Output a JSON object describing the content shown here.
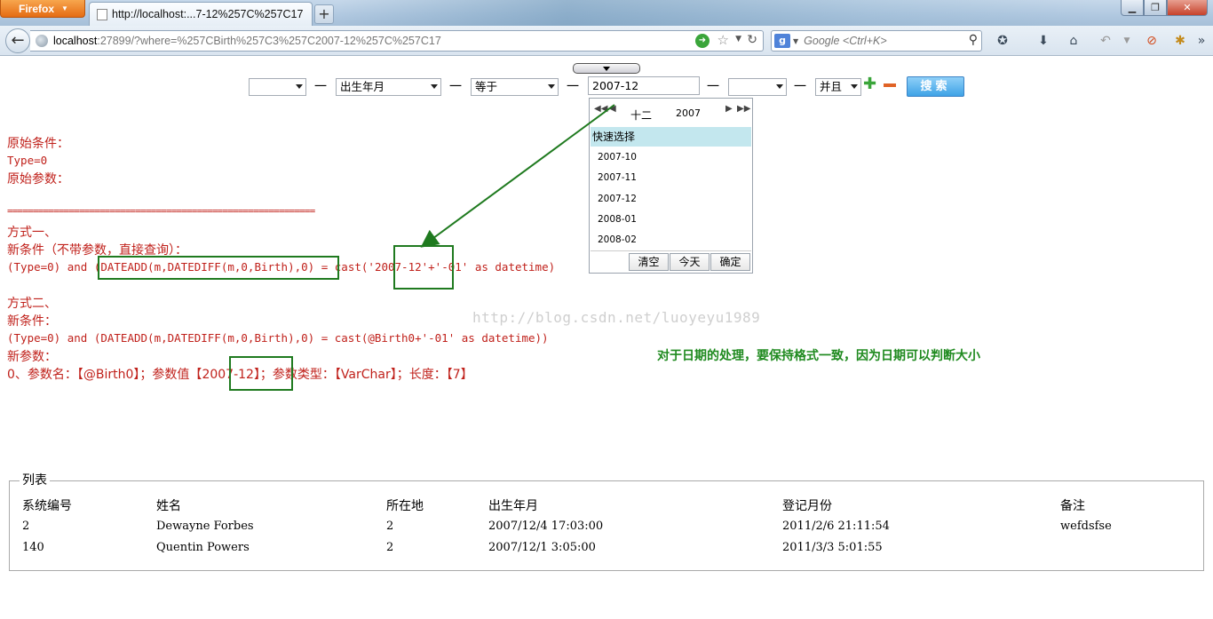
{
  "browser": {
    "app_button": "Firefox",
    "tab_title": "http://localhost:...7-12%257C%257C17",
    "new_tab": "+",
    "url_host": "localhost",
    "url_rest": ":27899/?where=%257CBirth%257C3%257C2007-12%257C%257C17",
    "search_placeholder": "Google <Ctrl+K>",
    "search_engine": "g"
  },
  "filter": {
    "field1": "",
    "field2": "出生年月",
    "operator": "等于",
    "value": "2007-12",
    "field5": "",
    "connector": "并且",
    "dash": "一",
    "search_label": "搜索"
  },
  "picker": {
    "month": "十二",
    "year": "2007",
    "quick_label": "快速选择",
    "options": [
      "2007-10",
      "2007-11",
      "2007-12",
      "2008-01",
      "2008-02"
    ],
    "clear": "清空",
    "today": "今天",
    "ok": "确定"
  },
  "output": {
    "orig_cond_label": "原始条件：",
    "orig_cond": "Type=0",
    "orig_params_label": "原始参数：",
    "separator": "============================================================",
    "method1": "方式一、",
    "new_cond_noparam": "新条件（不带参数，直接查询）：",
    "sql1_a": "(Type=0) and ",
    "sql1_b": "(DATEADD(m,DATEDIFF(m,0,Birth),0)",
    "sql1_c": " = cast('",
    "sql1_d": "2007-12",
    "sql1_e": "'+'-01' as datetime)",
    "method2": "方式二、",
    "new_cond": "新条件：",
    "sql2": "(Type=0) and (DATEADD(m,DATEDIFF(m,0,Birth),0) = cast(@Birth0+'-01' as datetime))",
    "new_params": "新参数：",
    "param_a": "0、参数名：【@Birth0】；参数值【",
    "param_value": "2007-12",
    "param_b": "】；参数类型：【VarChar】；长度：【7】",
    "note": "对于日期的处理，要保持格式一致，因为日期可以判断大小",
    "watermark": "http://blog.csdn.net/luoyeyu1989"
  },
  "list": {
    "legend": "列表",
    "headers": [
      "系统编号",
      "姓名",
      "所在地",
      "出生年月",
      "登记月份",
      "备注"
    ],
    "rows": [
      [
        "2",
        "Dewayne Forbes",
        "2",
        "2007/12/4 17:03:00",
        "2011/2/6 21:11:54",
        "wefdsfse"
      ],
      [
        "140",
        "Quentin Powers",
        "2",
        "2007/12/1 3:05:00",
        "2011/3/3 5:01:55",
        ""
      ]
    ]
  }
}
